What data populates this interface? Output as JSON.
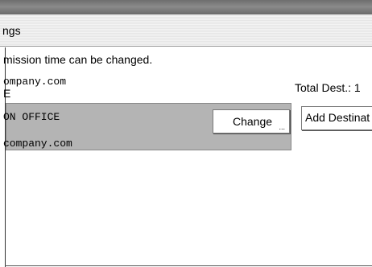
{
  "header": {
    "title_partial": "ngs"
  },
  "message": {
    "text": "mission time can be changed."
  },
  "sender": {
    "email_partial": "ompany.com",
    "line2_partial": "E"
  },
  "total_dest": {
    "text": "Total Dest.: 1"
  },
  "destination": {
    "name_partial": "ON OFFICE",
    "email_partial": "company.com"
  },
  "buttons": {
    "change": "Change",
    "change_dots": "...",
    "add_destination": "Add Destinat"
  }
}
